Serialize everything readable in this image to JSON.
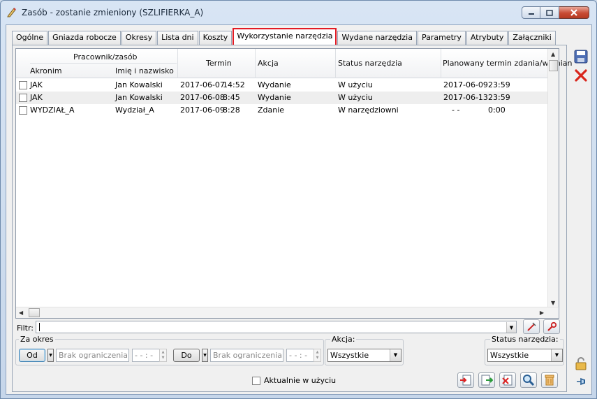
{
  "window": {
    "title": "Zasób - zostanie zmieniony  (SZLIFIERKA_A)"
  },
  "tabs": [
    {
      "label": "Ogólne"
    },
    {
      "label": "Gniazda robocze"
    },
    {
      "label": "Okresy"
    },
    {
      "label": "Lista dni"
    },
    {
      "label": "Koszty"
    },
    {
      "label": "Wykorzystanie narzędzia",
      "active": true
    },
    {
      "label": "Wydane narzędzia"
    },
    {
      "label": "Parametry"
    },
    {
      "label": "Atrybuty"
    },
    {
      "label": "Załączniki"
    }
  ],
  "grid": {
    "group_header": "Pracownik/zasób",
    "columns": {
      "akronim": "Akronim",
      "imie": "Imię i nazwisko",
      "termin": "Termin",
      "akcja": "Akcja",
      "status": "Status narzędzia",
      "planowany": "Planowany termin zdania/wymian"
    },
    "rows": [
      {
        "akronim": "JAK",
        "imie": "Jan Kowalski",
        "date": "2017-06-07",
        "time": "14:52",
        "akcja": "Wydanie",
        "status": "W użyciu",
        "plan_date": "2017-06-09",
        "plan_time": "23:59"
      },
      {
        "akronim": "JAK",
        "imie": "Jan Kowalski",
        "date": "2017-06-08",
        "time": "8:45",
        "akcja": "Wydanie",
        "status": "W użyciu",
        "plan_date": "2017-06-13",
        "plan_time": "23:59"
      },
      {
        "akronim": "WYDZIAŁ_A",
        "imie": "Wydział_A",
        "date": "2017-06-09",
        "time": "8:28",
        "akcja": "Zdanie",
        "status": "W narzędziowni",
        "plan_date": "-  -",
        "plan_time": "0:00"
      }
    ]
  },
  "filter": {
    "label": "Filtr:",
    "value": ""
  },
  "za_okres": {
    "legend": "Za okres",
    "od_label": "Od",
    "do_label": "Do",
    "od_value": "Brak ograniczenia",
    "do_value": "Brak ograniczenia",
    "time_placeholder": "- - : -"
  },
  "akcja": {
    "legend": "Akcja:",
    "selected": "Wszystkie"
  },
  "status_narzedzia": {
    "legend": "Status narzędzia:",
    "selected": "Wszystkie"
  },
  "aktualnie": {
    "label": "Aktualnie w użyciu",
    "checked": false
  },
  "colors": {
    "active_tab_border": "#e21b24",
    "close_button": "#c84b34",
    "alt_row": "#eeeeee"
  }
}
